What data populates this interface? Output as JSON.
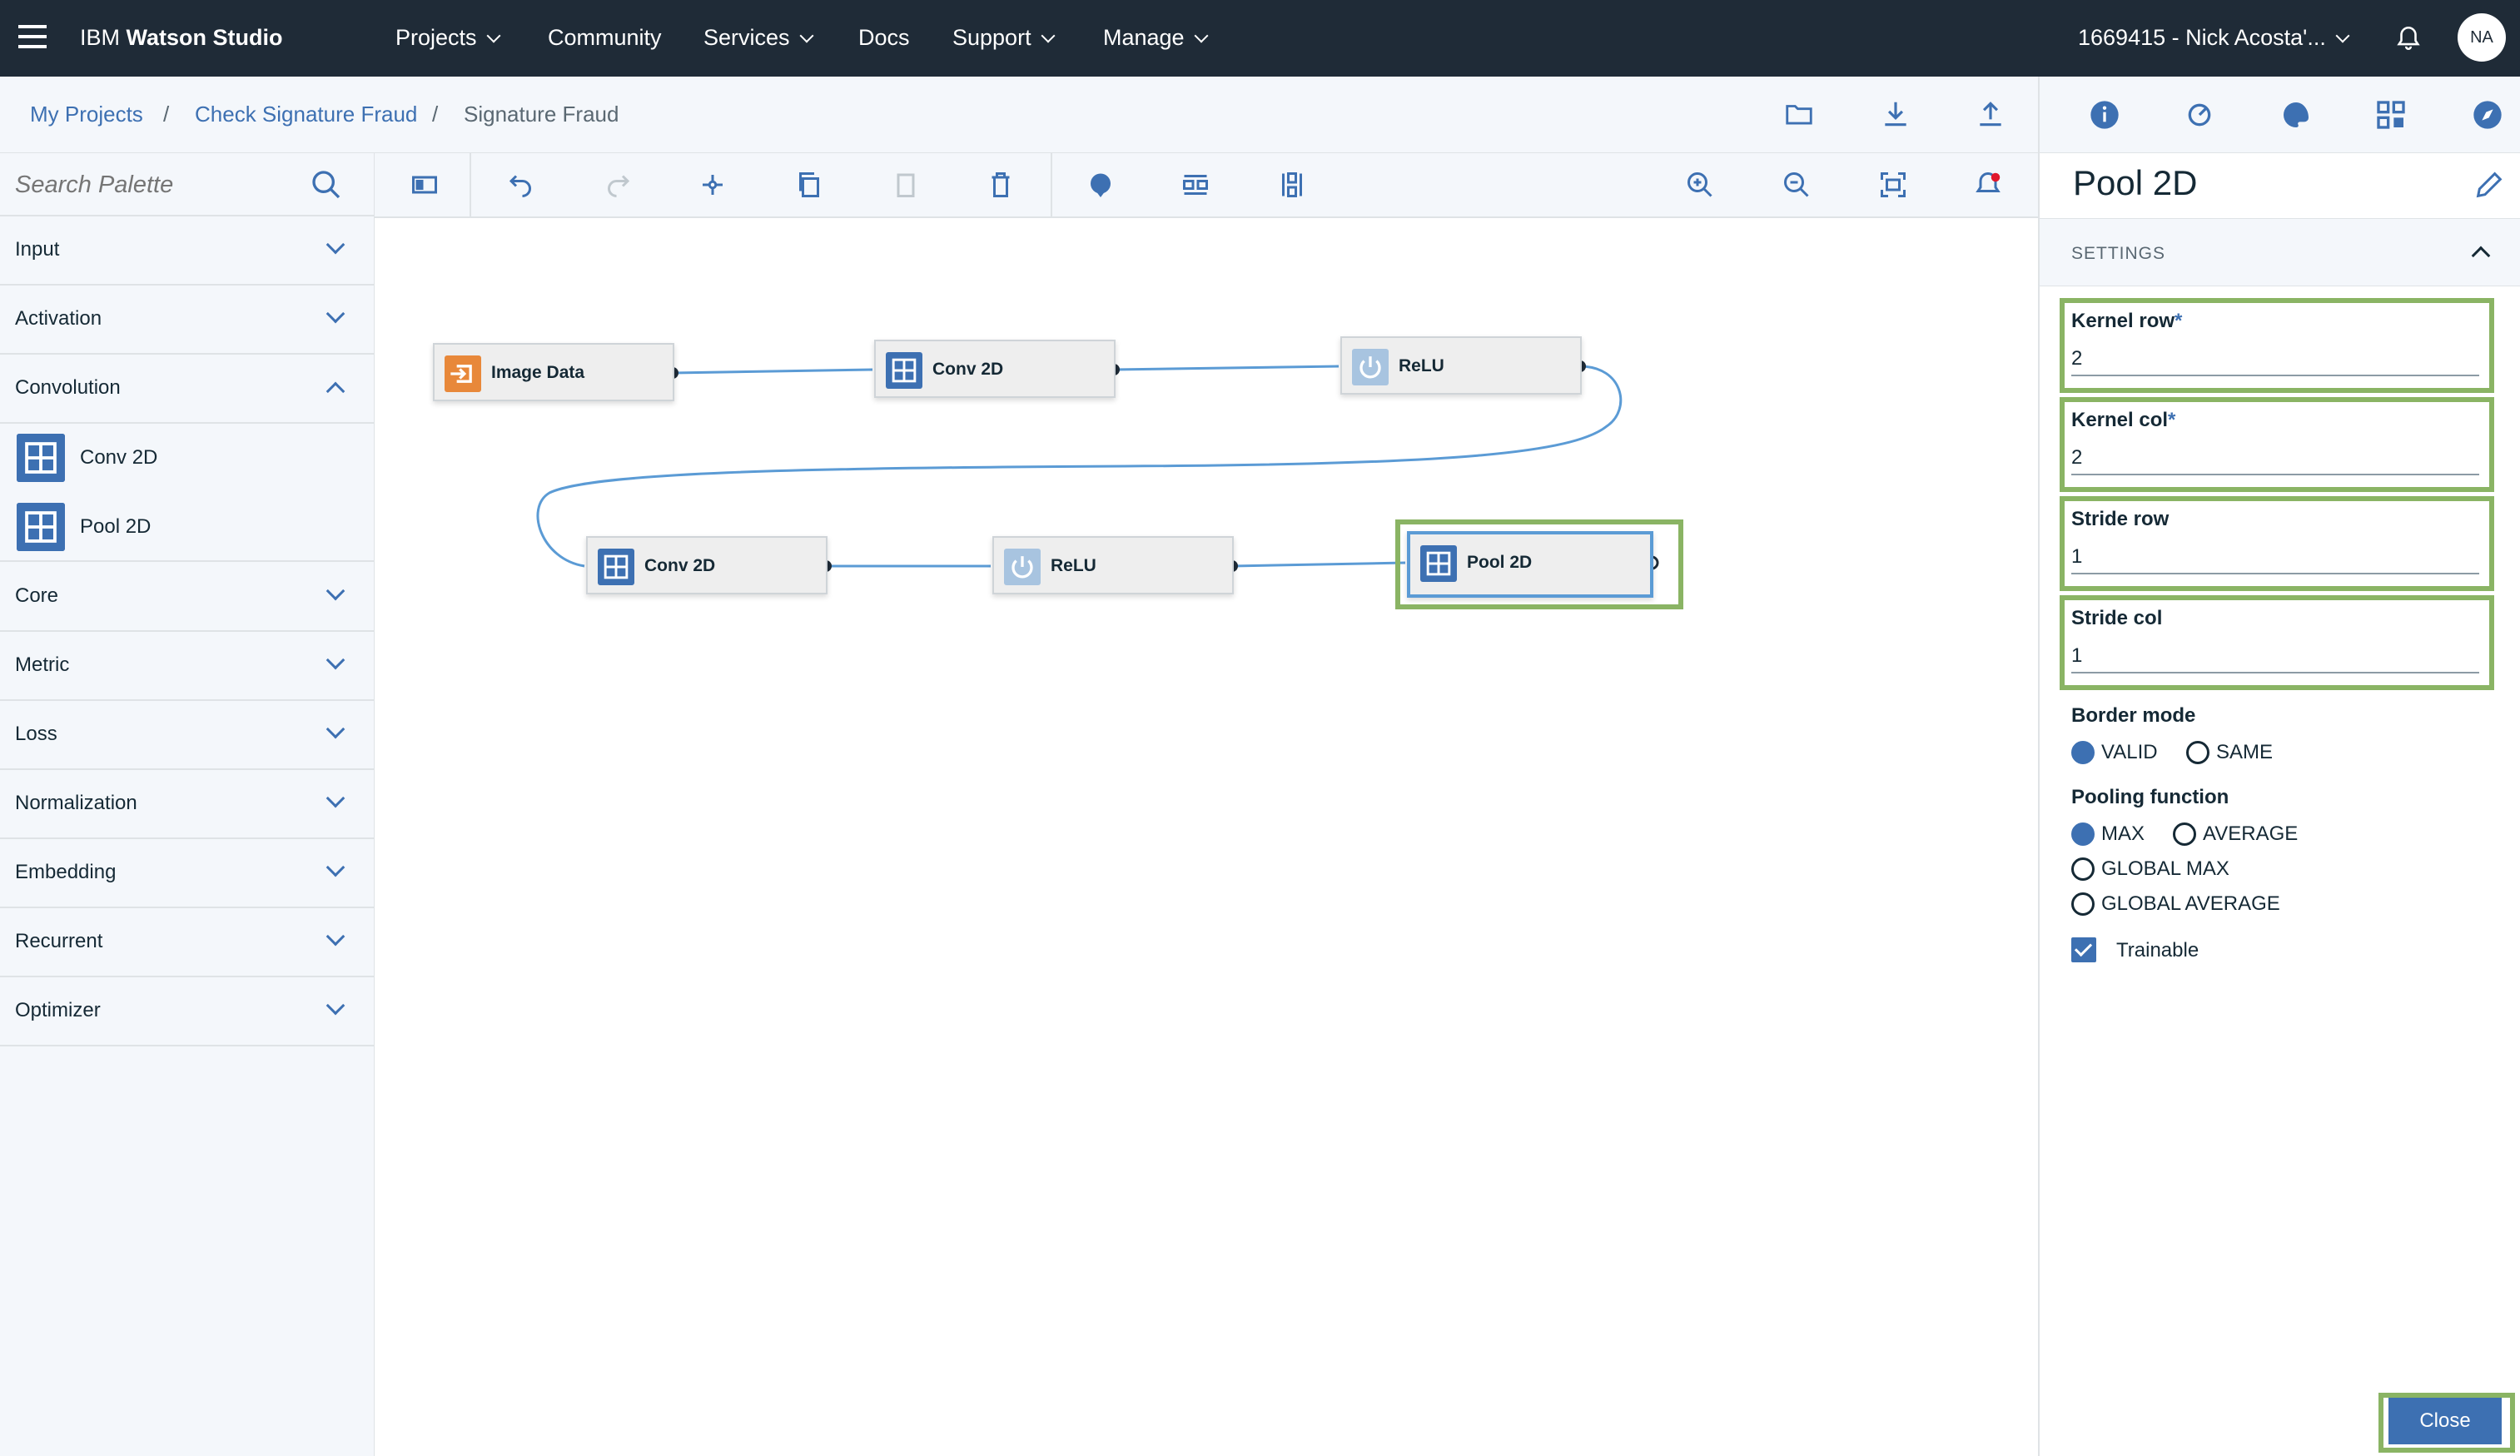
{
  "topbar": {
    "brand_prefix": "IBM",
    "brand_name": "Watson Studio",
    "nav": [
      {
        "label": "Projects"
      },
      {
        "label": "Community"
      },
      {
        "label": "Services"
      },
      {
        "label": "Docs"
      },
      {
        "label": "Support"
      },
      {
        "label": "Manage"
      }
    ],
    "account": "1669415 - Nick Acosta'...",
    "avatar_initials": "NA"
  },
  "breadcrumb": [
    {
      "label": "My Projects"
    },
    {
      "label": "Check Signature Fraud"
    },
    {
      "label": "Signature Fraud"
    }
  ],
  "breadcrumb_separator": "/",
  "palette": {
    "search_placeholder": "Search Palette",
    "categories": [
      {
        "label": "Input",
        "expanded": false
      },
      {
        "label": "Activation",
        "expanded": false
      },
      {
        "label": "Convolution",
        "expanded": true
      },
      {
        "label": "Core",
        "expanded": false
      },
      {
        "label": "Metric",
        "expanded": false
      },
      {
        "label": "Loss",
        "expanded": false
      },
      {
        "label": "Normalization",
        "expanded": false
      },
      {
        "label": "Embedding",
        "expanded": false
      },
      {
        "label": "Recurrent",
        "expanded": false
      },
      {
        "label": "Optimizer",
        "expanded": false
      }
    ],
    "convolution_items": [
      {
        "label": "Conv 2D",
        "icon": "grid-icon"
      },
      {
        "label": "Pool 2D",
        "icon": "grid-icon"
      }
    ]
  },
  "canvas": {
    "nodes": [
      {
        "label": "Image Data",
        "icon": "input-icon",
        "color": "#e8883a"
      },
      {
        "label": "Conv 2D",
        "icon": "grid-icon",
        "color": "#3d70b2"
      },
      {
        "label": "ReLU",
        "icon": "power-icon",
        "color": "#a8c4e0"
      },
      {
        "label": "Conv 2D",
        "icon": "grid-icon",
        "color": "#3d70b2"
      },
      {
        "label": "ReLU",
        "icon": "power-icon",
        "color": "#a8c4e0"
      },
      {
        "label": "Pool 2D",
        "icon": "grid-icon",
        "color": "#3d70b2"
      }
    ]
  },
  "properties": {
    "title": "Pool 2D",
    "section": "SETTINGS",
    "fields": [
      {
        "label": "Kernel row",
        "required": "*",
        "value": "2"
      },
      {
        "label": "Kernel col",
        "required": "*",
        "value": "2"
      },
      {
        "label": "Stride row",
        "required": "",
        "value": "1"
      },
      {
        "label": "Stride col",
        "required": "",
        "value": "1"
      }
    ],
    "border_mode": {
      "title": "Border mode",
      "options": [
        "VALID",
        "SAME"
      ],
      "selected": "VALID"
    },
    "pooling_function": {
      "title": "Pooling function",
      "options": [
        "MAX",
        "AVERAGE",
        "GLOBAL MAX",
        "GLOBAL AVERAGE"
      ],
      "selected": "MAX"
    },
    "trainable": {
      "label": "Trainable",
      "checked": true
    },
    "close_label": "Close"
  },
  "colors": {
    "topbar": "#1f2b37",
    "accent": "#3d70b2",
    "highlight": "#8ab464",
    "link": "#5b9bd5"
  }
}
